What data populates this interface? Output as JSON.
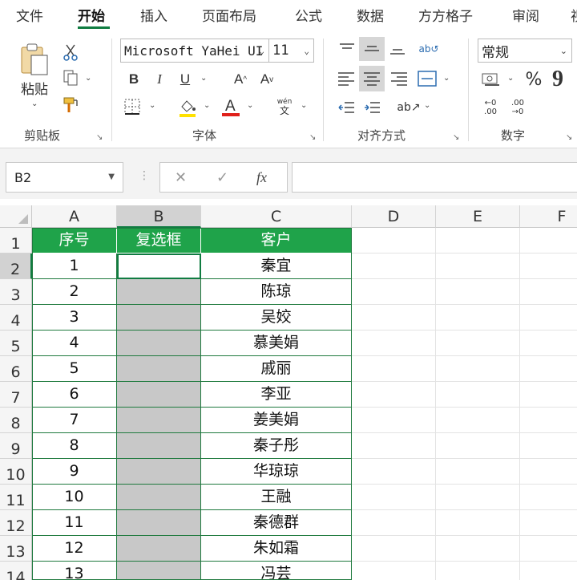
{
  "tabs": [
    {
      "label": "文件",
      "active": false
    },
    {
      "label": "开始",
      "active": true
    },
    {
      "label": "插入",
      "active": false
    },
    {
      "label": "页面布局",
      "active": false
    },
    {
      "label": "公式",
      "active": false
    },
    {
      "label": "数据",
      "active": false
    },
    {
      "label": "方方格子",
      "active": false
    },
    {
      "label": "审阅",
      "active": false
    },
    {
      "label": "视",
      "active": false
    }
  ],
  "ribbon": {
    "clipboard": {
      "label": "剪贴板",
      "paste_label": "粘贴"
    },
    "font": {
      "label": "字体",
      "font_name": "Microsoft YaHei UI",
      "font_size": "11",
      "pinyin_top": "wén",
      "pinyin_bottom": "文"
    },
    "alignment": {
      "label": "对齐方式"
    },
    "number": {
      "label": "数字",
      "format": "常规"
    }
  },
  "formula_bar": {
    "name_box": "B2",
    "formula": ""
  },
  "sheet": {
    "columns": [
      "A",
      "B",
      "C",
      "D",
      "E",
      "F"
    ],
    "selected_column": "B",
    "selected_row": "2",
    "active_cell": "B2",
    "table_header": [
      "序号",
      "复选框",
      "客户"
    ],
    "rows": [
      {
        "row": "1"
      },
      {
        "row": "2",
        "a": "1",
        "c": "秦宜"
      },
      {
        "row": "3",
        "a": "2",
        "c": "陈琼"
      },
      {
        "row": "4",
        "a": "3",
        "c": "吴姣"
      },
      {
        "row": "5",
        "a": "4",
        "c": "慕美娟"
      },
      {
        "row": "6",
        "a": "5",
        "c": "戚丽"
      },
      {
        "row": "7",
        "a": "6",
        "c": "李亚"
      },
      {
        "row": "8",
        "a": "7",
        "c": "姜美娟"
      },
      {
        "row": "9",
        "a": "8",
        "c": "秦子彤"
      },
      {
        "row": "10",
        "a": "9",
        "c": "华琼琼"
      },
      {
        "row": "11",
        "a": "10",
        "c": "王融"
      },
      {
        "row": "12",
        "a": "11",
        "c": "秦德群"
      },
      {
        "row": "13",
        "a": "12",
        "c": "朱如霜"
      },
      {
        "row": "14",
        "a": "13",
        "c": "冯芸"
      }
    ]
  },
  "colors": {
    "accent": "#107c41",
    "header_fill": "#1fa34a",
    "checkbox_fill": "#c8c8c8"
  }
}
